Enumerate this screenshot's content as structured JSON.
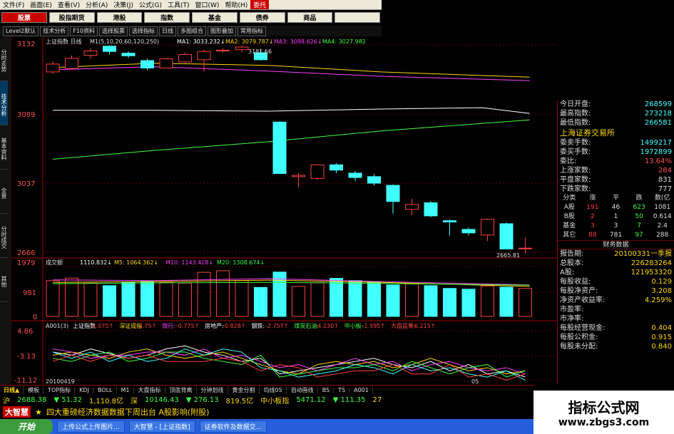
{
  "menu": [
    "文件(F)",
    "画面(E)",
    "查看(V)",
    "分析(A)",
    "决策(J)",
    "公式(G)",
    "工具(T)",
    "窗口(W)",
    "帮助(H)",
    "委托"
  ],
  "tabs": [
    "股票",
    "股指期货",
    "港股",
    "指数",
    "基金",
    "债券",
    "商品",
    ""
  ],
  "toolbar": [
    "Level2默认",
    "技术分析",
    "F10资料",
    "选择股票",
    "选择指标",
    "日线",
    "多图组合",
    "图形叠加",
    "常用指标"
  ],
  "left_tabs": [
    "分时走势",
    "技术分析",
    "基本资料",
    "全景",
    "分时成交",
    "其他"
  ],
  "chart": {
    "title": "上证指数 日线",
    "params": "M1(5,10,20,60,120,250)",
    "ma_labels": [
      {
        "text": "MA1: 3033.232↓",
        "color": "#ffffff"
      },
      {
        "text": "MA2: 3079.787↓",
        "color": "#ffd800"
      },
      {
        "text": "MA3: 3098.626↓",
        "color": "#ff40ff"
      },
      {
        "text": "MA4: 3027.982",
        "color": "#40ff40"
      }
    ],
    "price_ticks": [
      "3132",
      "3089",
      "3037",
      "2666"
    ],
    "high_label": "3181.66",
    "low_label": "2665.81",
    "vol_title": "成交额",
    "vol_labels": [
      "1110.832↓",
      "M5: 1064.362↓",
      "M10: 1143.428↓",
      "M20: 1308.674↓"
    ],
    "vol_ticks": [
      "1979",
      "981",
      "0"
    ],
    "ind_title": "A001(3)",
    "ind_labels": [
      {
        "text": "上证指数",
        "color": "#ffffff"
      },
      {
        "text": "-1.075↑",
        "color": "#ff4040"
      },
      {
        "text": "深证成指",
        "color": "#ffd800"
      },
      {
        "text": "-1.75↑",
        "color": "#ff4040"
      },
      {
        "text": "银行:",
        "color": "#ff40ff"
      },
      {
        "text": "-0.775↑",
        "color": "#ff4040"
      },
      {
        "text": "房地产:",
        "color": "#ffffff"
      },
      {
        "text": "-0.828↑",
        "color": "#ff4040"
      },
      {
        "text": "钢铁:",
        "color": "#ffffff"
      },
      {
        "text": "-2.757↑",
        "color": "#ff4040"
      },
      {
        "text": "煤炭石油:",
        "color": "#40ff40"
      },
      {
        "text": "-4.230↑",
        "color": "#ff4040"
      },
      {
        "text": "中小板:",
        "color": "#40ff40"
      },
      {
        "text": "-1.995↑",
        "color": "#ff4040"
      },
      {
        "text": "大盘蓝筹:",
        "color": "#ff4040"
      },
      {
        "text": "-6.215↑",
        "color": "#ff4040"
      }
    ],
    "ind_ticks": [
      "4.86",
      "-3.13",
      "-11.12"
    ],
    "date_label": "20100419",
    "date_label_right": "05"
  },
  "right_panel": {
    "top_rows": [
      {
        "label": "今日开盘:",
        "value": "268599"
      },
      {
        "label": "最高指数:",
        "value": "273218"
      },
      {
        "label": "最低指数:",
        "value": "266581"
      }
    ],
    "exchange": "上海证券交易所",
    "mid_rows": [
      {
        "label": "委卖手数:",
        "value": "1499217"
      },
      {
        "label": "委买手数:",
        "value": "1972899"
      },
      {
        "label": "委比:",
        "value": "13.64%"
      },
      {
        "label": "上涨家数:",
        "value": "284"
      },
      {
        "label": "平盘家数:",
        "value": "831"
      },
      {
        "label": "下跌家数:",
        "value": "777"
      }
    ],
    "grid_header": [
      "分类",
      "涨",
      "平",
      "跌",
      "数(亿"
    ],
    "grid_rows": [
      [
        "A股",
        "191",
        "46",
        "623",
        "1081"
      ],
      [
        "B股",
        "2",
        "1",
        "50",
        "0.614"
      ],
      [
        "基金",
        "3",
        "3",
        "7",
        "2.4"
      ],
      [
        "其它",
        "88",
        "781",
        "97",
        "288"
      ]
    ],
    "fin_title": "财务数据",
    "fin_rows": [
      {
        "label": "报告期:",
        "value": "20100331一季报"
      },
      {
        "label": "总股本:",
        "value": "226283264"
      },
      {
        "label": "A股:",
        "value": "121953320"
      },
      {
        "label": "每股收益:",
        "value": "0.129"
      },
      {
        "label": "每股净资产:",
        "value": "3.208"
      },
      {
        "label": "净资产收益率:",
        "value": "4.259%"
      },
      {
        "label": "市盈率:",
        "value": ""
      },
      {
        "label": "市净率:",
        "value": ""
      },
      {
        "label": "每股经营现金:",
        "value": "0.404"
      },
      {
        "label": "每股公积金:",
        "value": "0.915"
      },
      {
        "label": "每股未分配:",
        "value": "0.840"
      }
    ]
  },
  "bottom_tabs": [
    "日线▲",
    "模板",
    "TOP指标",
    "KDJ",
    "BOLL",
    "M1",
    "大盘指标",
    "顶底背离",
    "分钟划线",
    "黄金分割",
    "均线05",
    "自动画线",
    "BS",
    "TS",
    "A001"
  ],
  "ticker": [
    {
      "text": "沪",
      "color": "#ffd800"
    },
    {
      "text": "2688.38",
      "color": "#40ff40"
    },
    {
      "text": "▼ 51.32",
      "color": "#40ff40"
    },
    {
      "text": "1,110.8亿",
      "color": "#ffd800"
    },
    {
      "text": "深",
      "color": "#ffd800"
    },
    {
      "text": "10146.43",
      "color": "#40ff40"
    },
    {
      "text": "▼ 276.13",
      "color": "#40ff40"
    },
    {
      "text": "819.5亿",
      "color": "#ffd800"
    },
    {
      "text": "中小板指",
      "color": "#ffd800"
    },
    {
      "text": "5471.12",
      "color": "#40ff40"
    },
    {
      "text": "▼ 111.35",
      "color": "#40ff40"
    },
    {
      "text": "27",
      "color": "#ffd800"
    }
  ],
  "marquee": {
    "logo": "大智慧",
    "star": "★",
    "text": "四大重磅经济数据数据下周出台 A股影响(附股)"
  },
  "taskbar": {
    "start": "开始",
    "tasks": [
      "上传公式上传图片...",
      "大智慧 - [上证指数]",
      "证券软件及数据交..."
    ]
  },
  "watermark": {
    "title": "指标公式网",
    "url": "www.zbgs3.com"
  },
  "colors": {
    "up": "#ff4040",
    "down": "#40ffff",
    "accent": "#c00000"
  },
  "candles": [
    {
      "o": 3070,
      "c": 3088,
      "h": 3094,
      "l": 3066
    },
    {
      "o": 3078,
      "c": 3101,
      "h": 3108,
      "l": 3075
    },
    {
      "o": 3108,
      "c": 3118,
      "h": 3125,
      "l": 3101
    },
    {
      "o": 3129,
      "c": 3117,
      "h": 3131,
      "l": 3110
    },
    {
      "o": 3113,
      "c": 3107,
      "h": 3117,
      "l": 3102
    },
    {
      "o": 3096,
      "c": 3079,
      "h": 3101,
      "l": 3074
    },
    {
      "o": 3079,
      "c": 3100,
      "h": 3102,
      "l": 3078
    },
    {
      "o": 3093,
      "c": 3110,
      "h": 3115,
      "l": 3091
    },
    {
      "o": 3098,
      "c": 3117,
      "h": 3121,
      "l": 3071
    },
    {
      "o": 3118,
      "c": 3120,
      "h": 3124,
      "l": 3114
    },
    {
      "o": 3121,
      "c": 3127,
      "h": 3131,
      "l": 3115
    },
    {
      "o": 3114,
      "c": 3098,
      "h": 3123,
      "l": 3096
    },
    {
      "o": 2955,
      "c": 2837,
      "h": 2957,
      "l": 2836
    },
    {
      "o": 2830,
      "c": 2833,
      "h": 2838,
      "l": 2806
    },
    {
      "o": 2826,
      "c": 2857,
      "h": 2858,
      "l": 2822
    },
    {
      "o": 2857,
      "c": 2845,
      "h": 2861,
      "l": 2838
    },
    {
      "o": 2838,
      "c": 2828,
      "h": 2843,
      "l": 2820
    },
    {
      "o": 2830,
      "c": 2815,
      "h": 2836,
      "l": 2810
    },
    {
      "o": 2810,
      "c": 2773,
      "h": 2812,
      "l": 2745
    },
    {
      "o": 2755,
      "c": 2766,
      "h": 2779,
      "l": 2741
    },
    {
      "o": 2770,
      "c": 2740,
      "h": 2774,
      "l": 2737
    },
    {
      "o": 2729,
      "c": 2726,
      "h": 2732,
      "l": 2695
    },
    {
      "o": 2709,
      "c": 2701,
      "h": 2713,
      "l": 2695
    },
    {
      "o": 2696,
      "c": 2732,
      "h": 2734,
      "l": 2682
    },
    {
      "o": 2722,
      "c": 2664,
      "h": 2725,
      "l": 2663
    },
    {
      "o": 2666,
      "c": 2666,
      "h": 2690,
      "l": 2654
    }
  ],
  "volume": [
    1420,
    1520,
    1320,
    1220,
    1350,
    1390,
    1350,
    1320,
    1750,
    1810,
    1420,
    1150,
    1760,
    1190,
    1340,
    1510,
    1420,
    1380,
    1250,
    1290,
    1220,
    1110,
    1080,
    1210,
    1160,
    1110
  ]
}
